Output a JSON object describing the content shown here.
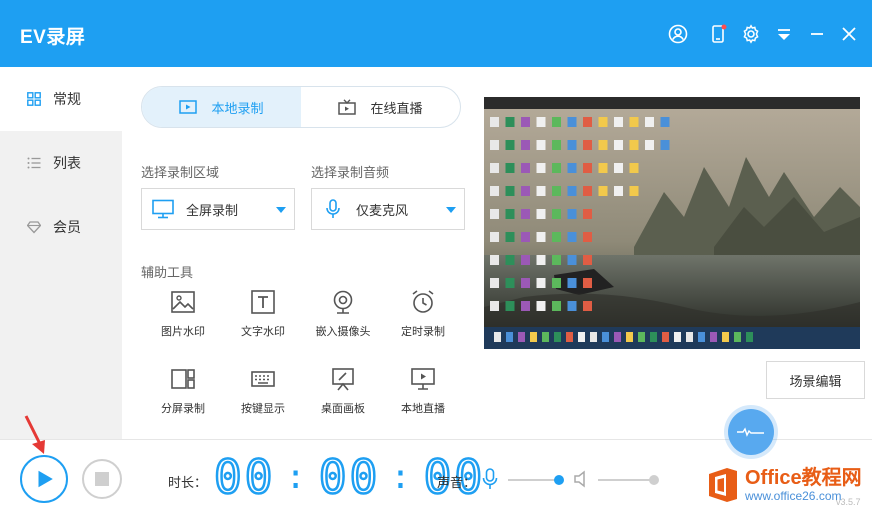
{
  "app": {
    "title": "EV录屏",
    "version": "v3.5.7"
  },
  "sidebar": {
    "items": [
      {
        "label": "常规",
        "icon": "grid-icon",
        "active": true
      },
      {
        "label": "列表",
        "icon": "list-icon",
        "active": false
      },
      {
        "label": "会员",
        "icon": "diamond-icon",
        "active": false
      }
    ]
  },
  "mode_tabs": [
    {
      "label": "本地录制",
      "icon": "record-screen-icon",
      "active": true
    },
    {
      "label": "在线直播",
      "icon": "tv-icon",
      "active": false
    }
  ],
  "record_area": {
    "label": "选择录制区域",
    "value": "全屏录制"
  },
  "record_audio": {
    "label": "选择录制音频",
    "value": "仅麦克风"
  },
  "tools": {
    "label": "辅助工具",
    "items": [
      {
        "label": "图片水印",
        "icon": "image-icon"
      },
      {
        "label": "文字水印",
        "icon": "text-icon"
      },
      {
        "label": "嵌入摄像头",
        "icon": "webcam-icon"
      },
      {
        "label": "定时录制",
        "icon": "alarm-clock-icon"
      },
      {
        "label": "分屏录制",
        "icon": "split-screen-icon"
      },
      {
        "label": "按键显示",
        "icon": "keyboard-icon"
      },
      {
        "label": "桌面画板",
        "icon": "easel-icon"
      },
      {
        "label": "本地直播",
        "icon": "monitor-play-icon"
      }
    ]
  },
  "scene_edit_label": "场景编辑",
  "bottom": {
    "duration_label": "时长：",
    "timer": {
      "hh": "00",
      "mm": "00",
      "ss": "00"
    },
    "sound_label": "声音：",
    "mic_volume": 0.95,
    "speaker_volume": 1.0
  },
  "watermark": {
    "line1": "Office教程网",
    "line2": "www.office26.com"
  },
  "colors": {
    "accent": "#1e9ff2",
    "sidebar_bg": "#f1f1f1",
    "watermark_orange": "#e85d16"
  }
}
